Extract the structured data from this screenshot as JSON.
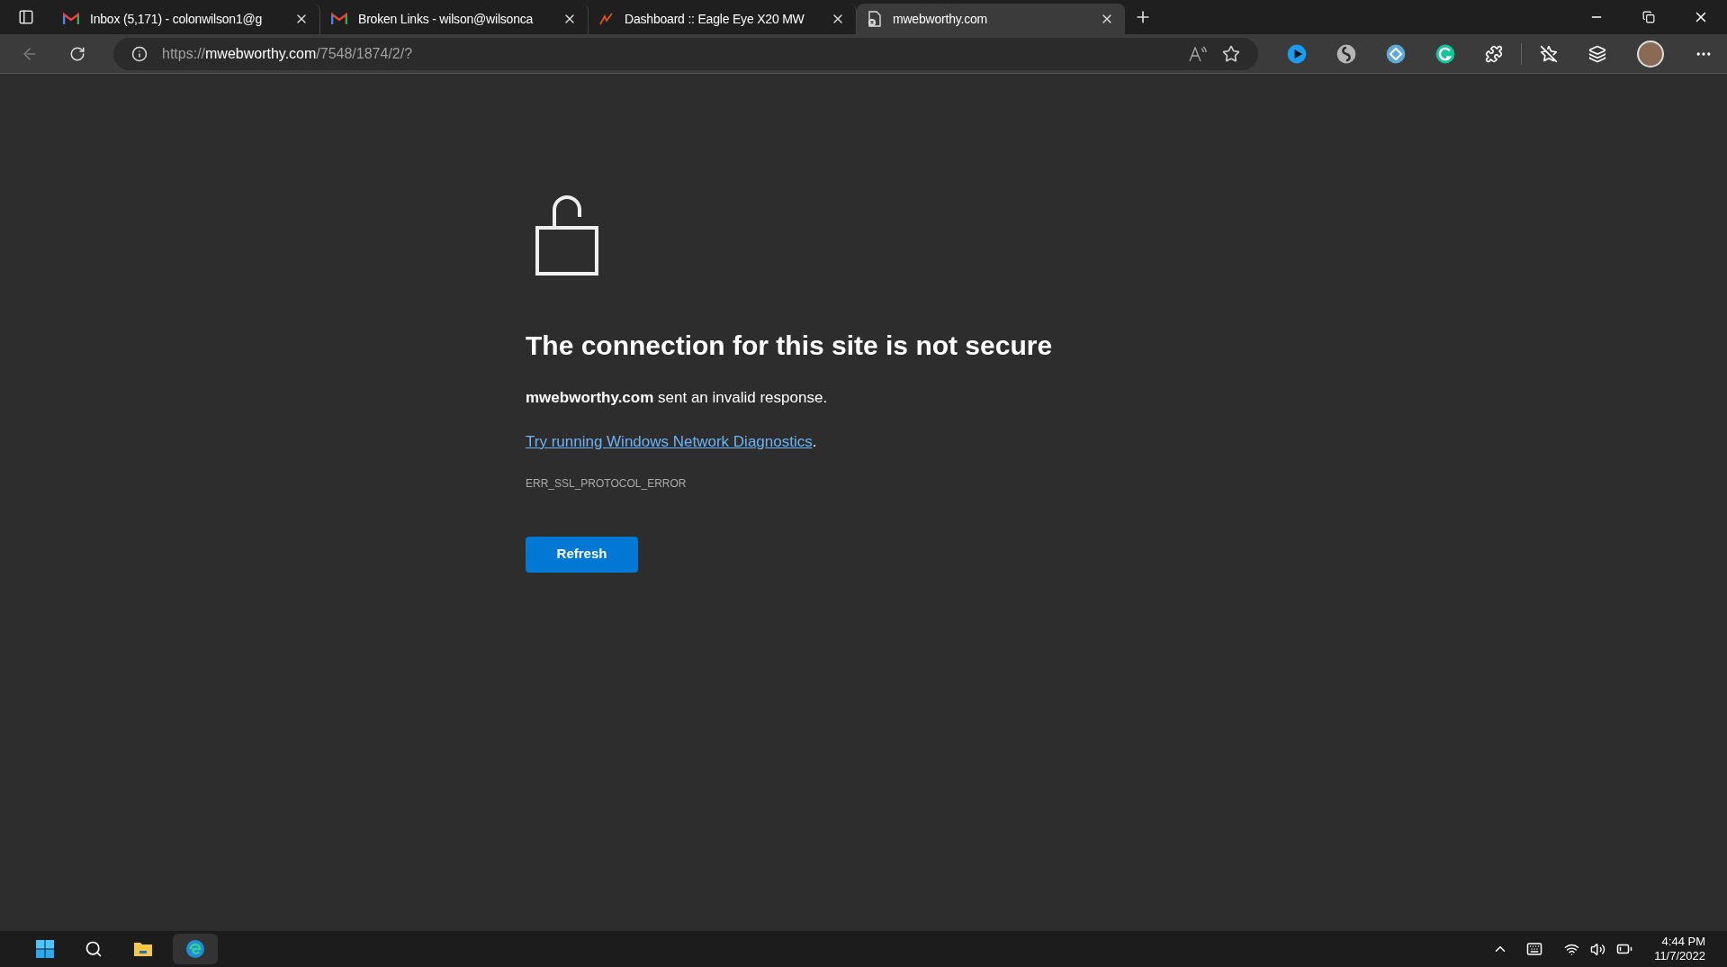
{
  "tabs": [
    {
      "kind": "gmail",
      "title": "Inbox (5,171) - colonwilson1@g",
      "selected": false
    },
    {
      "kind": "gmail",
      "title": "Broken Links - wilson@wilsonca",
      "selected": false
    },
    {
      "kind": "chart",
      "title": "Dashboard :: Eagle Eye X20 MW",
      "selected": false
    },
    {
      "kind": "error",
      "title": "mwebworthy.com",
      "selected": true
    }
  ],
  "address_bar": {
    "scheme": "https://",
    "host": "mwebworthy.com",
    "path": "/7548/1874/2/?"
  },
  "extensions": [
    {
      "kind": "play",
      "color": "#1a9cf0"
    },
    {
      "kind": "swirl",
      "color": "#b5b5b5"
    },
    {
      "kind": "diamond",
      "color": "#5fa9d6"
    },
    {
      "kind": "g",
      "color": "#15c39a"
    }
  ],
  "page": {
    "heading": "The connection for this site is not secure",
    "message": "**mwebworthy.com** sent an invalid response.",
    "link": "Try running Windows Network Diagnostics",
    "link_suffix": ".",
    "error_code": "ERR_SSL_PROTOCOL_ERROR",
    "button": "Refresh"
  },
  "taskbar": {
    "time": "4:44 PM",
    "date": "11/7/2022"
  }
}
